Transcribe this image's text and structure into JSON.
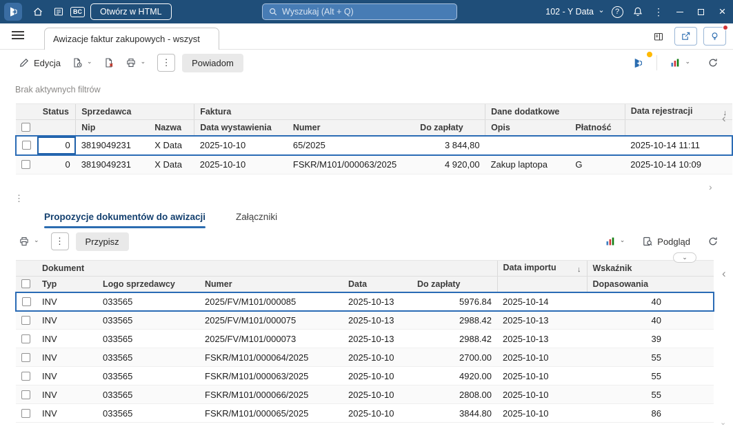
{
  "topbar": {
    "open_in_html_label": "Otwórz w HTML",
    "search_placeholder": "Wyszukaj (Alt + Q)",
    "company_label": "102 - Y Data",
    "bc_badge": "BC"
  },
  "caption": {
    "tab_title": "Awizacje faktur zakupowych - wszyst"
  },
  "toolbar1": {
    "edit_label": "Edycja",
    "notify_label": "Powiadom"
  },
  "filter_status": "Brak aktywnych filtrów",
  "grid1": {
    "group_headers": {
      "status": "Status",
      "sprzedawca": "Sprzedawca",
      "faktura": "Faktura",
      "dane_dodatkowe": "Dane dodatkowe",
      "data_rejestracji": "Data rejestracji"
    },
    "column_headers": {
      "nip": "Nip",
      "nazwa": "Nazwa",
      "data_wystawienia": "Data wystawienia",
      "numer": "Numer",
      "do_zaplaty": "Do zapłaty",
      "opis": "Opis",
      "platnosc": "Płatność"
    },
    "rows": [
      {
        "status": "0",
        "nip": "3819049231",
        "nazwa": "X Data",
        "data_wystawienia": "2025-10-10",
        "numer": "65/2025",
        "do_zaplaty": "3 844,80",
        "opis": "",
        "platnosc": "",
        "data_rejestracji": "2025-10-14 11:11"
      },
      {
        "status": "0",
        "nip": "3819049231",
        "nazwa": "X Data",
        "data_wystawienia": "2025-10-10",
        "numer": "FSKR/M101/000063/2025",
        "do_zaplaty": "4 920,00",
        "opis": "Zakup laptopa",
        "platnosc": "G",
        "data_rejestracji": "2025-10-14 10:09"
      }
    ]
  },
  "bottom_tabs": {
    "proposals": "Propozycje dokumentów do awizacji",
    "attachments": "Załączniki"
  },
  "toolbar2": {
    "assign_label": "Przypisz",
    "preview_label": "Podgląd"
  },
  "grid2": {
    "group_headers": {
      "dokument": "Dokument",
      "data_importu": "Data importu",
      "wskaznik": "Wskaźnik"
    },
    "column_headers": {
      "typ": "Typ",
      "logo_sprzedawcy": "Logo sprzedawcy",
      "numer": "Numer",
      "data": "Data",
      "do_zaplaty": "Do zapłaty",
      "dopasowania": "Dopasowania"
    },
    "rows": [
      {
        "typ": "INV",
        "logo": "033565",
        "numer": "2025/FV/M101/000085",
        "data": "2025-10-13",
        "do_zaplaty": "5976.84",
        "data_importu": "2025-10-14",
        "wskaznik": "40"
      },
      {
        "typ": "INV",
        "logo": "033565",
        "numer": "2025/FV/M101/000075",
        "data": "2025-10-13",
        "do_zaplaty": "2988.42",
        "data_importu": "2025-10-13",
        "wskaznik": "40"
      },
      {
        "typ": "INV",
        "logo": "033565",
        "numer": "2025/FV/M101/000073",
        "data": "2025-10-13",
        "do_zaplaty": "2988.42",
        "data_importu": "2025-10-13",
        "wskaznik": "39"
      },
      {
        "typ": "INV",
        "logo": "033565",
        "numer": "FSKR/M101/000064/2025",
        "data": "2025-10-10",
        "do_zaplaty": "2700.00",
        "data_importu": "2025-10-10",
        "wskaznik": "55"
      },
      {
        "typ": "INV",
        "logo": "033565",
        "numer": "FSKR/M101/000063/2025",
        "data": "2025-10-10",
        "do_zaplaty": "4920.00",
        "data_importu": "2025-10-10",
        "wskaznik": "55"
      },
      {
        "typ": "INV",
        "logo": "033565",
        "numer": "FSKR/M101/000066/2025",
        "data": "2025-10-10",
        "do_zaplaty": "2808.00",
        "data_importu": "2025-10-10",
        "wskaznik": "55"
      },
      {
        "typ": "INV",
        "logo": "033565",
        "numer": "FSKR/M101/000065/2025",
        "data": "2025-10-10",
        "do_zaplaty": "3844.80",
        "data_importu": "2025-10-10",
        "wskaznik": "86"
      }
    ]
  },
  "icons": {
    "chevron_down": "⌄",
    "more_vertical": "⋮",
    "sort_desc": "↓",
    "collapse_pane": "‹",
    "scroll_right": "›",
    "scroll_down": "⌄",
    "close": "×",
    "help": "?",
    "splitter_handle": "⋮"
  },
  "colors": {
    "header_bar": "#1f4e79",
    "selection_border": "#2a6bb5",
    "tab_underline": "#2b6cb0",
    "alert_dot": "#d13438",
    "notify_dot": "#ffb900"
  }
}
